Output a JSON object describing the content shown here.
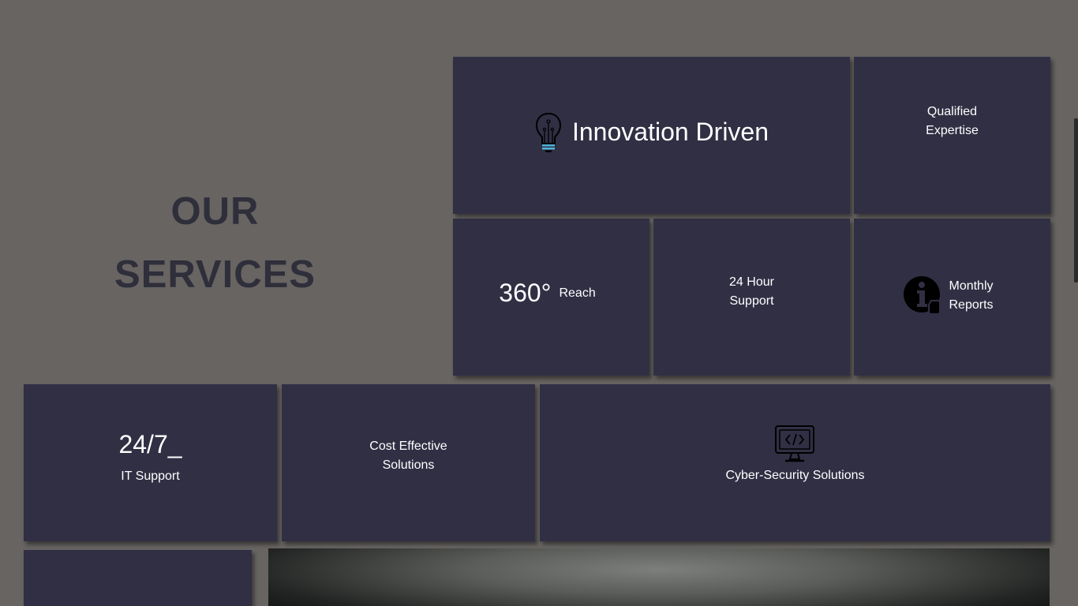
{
  "title": {
    "line1": "OUR",
    "line2": "SERVICES"
  },
  "cards": {
    "innovation": {
      "label": "Innovation Driven",
      "icon": "lightbulb-icon"
    },
    "qualified": {
      "line1": "Qualified",
      "line2": "Expertise"
    },
    "reach": {
      "number": "360°",
      "label": "Reach"
    },
    "support24": {
      "line1": "24 Hour",
      "line2": "Support"
    },
    "monthly": {
      "line1": "Monthly",
      "line2": "Reports",
      "icon": "info-icon"
    },
    "itsupport": {
      "number": "24/7_",
      "label": "IT Support"
    },
    "cost": {
      "line1": "Cost Effective",
      "line2": "Solutions"
    },
    "cyber": {
      "label": "Cyber-Security Solutions",
      "icon": "code-monitor-icon"
    }
  },
  "colors": {
    "background": "#676462",
    "card": "#302f44",
    "text": "#ffffff",
    "title": "#2f2f3b",
    "accent": "#4fb3d9"
  }
}
